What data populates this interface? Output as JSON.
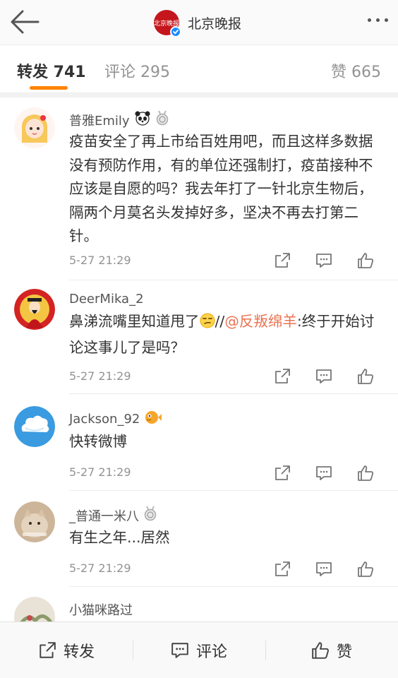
{
  "header": {
    "title": "北京晚报",
    "logo_text": "北京晚报",
    "back_icon": "back-arrow-icon",
    "more_icon": "more-dots-icon"
  },
  "tabs": {
    "repost": "转发 741",
    "comment": "评论 295",
    "like": "赞 665"
  },
  "comments": [
    {
      "username": "普雅Emily",
      "badges": [
        "panda-icon",
        "medal-icon"
      ],
      "content": "疫苗安全了再上市给百姓用吧，而且这样多数据没有预防作用，有的单位还强制打，疫苗接种不应该是自愿的吗？我去年打了一针北京生物后，隔两个月莫名头发掉好多，坚决不再去打第二针。",
      "time": "5-27 21:29"
    },
    {
      "username": "DeerMika_2",
      "badges": [],
      "content_before": "鼻涕流嘴里知道甩了",
      "content_sep": "//",
      "mention": "@反叛绵羊",
      "content_after": ":终于开始讨论这事儿了是吗？",
      "time": "5-27 21:29"
    },
    {
      "username": "Jackson_92",
      "badges": [
        "pufferfish-icon"
      ],
      "content": "快转微博",
      "time": "5-27 21:29"
    },
    {
      "username": "_普通一米八",
      "badges": [
        "medal-icon"
      ],
      "content": "有生之年...居然",
      "time": "5-27 21:29"
    },
    {
      "username": "小猫咪路过",
      "badges": []
    }
  ],
  "bottom": {
    "repost": "转发",
    "comment": "评论",
    "like": "赞"
  },
  "colors": {
    "accent": "#ff8200",
    "mention": "#eb7350",
    "verified": "#1a8cff",
    "brand": "#c4161c"
  }
}
